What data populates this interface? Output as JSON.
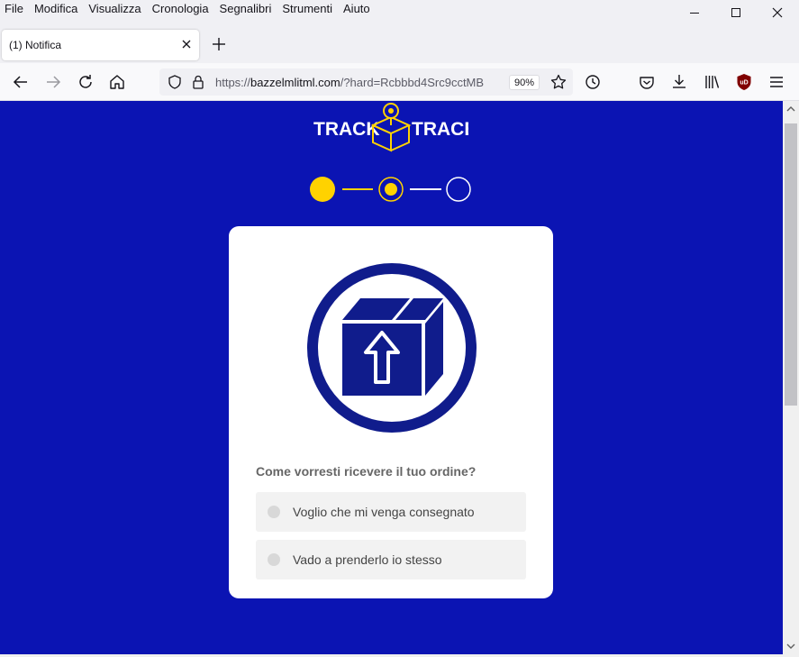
{
  "menu": [
    "File",
    "Modifica",
    "Visualizza",
    "Cronologia",
    "Segnalibri",
    "Strumenti",
    "Aiuto"
  ],
  "tab": {
    "title": "(1) Notifica"
  },
  "navbar": {
    "url_scheme": "https://",
    "url_host": "bazzelmlitml.com",
    "url_path": "/?hard=Rcbbbd4Src9cctMB",
    "zoom": "90%"
  },
  "page": {
    "logo_left": "TRACK",
    "logo_right": "TRACE",
    "progress_step": 2,
    "progress_total": 3,
    "question": "Come vorresti ricevere il tuo ordine?",
    "options": [
      "Voglio che mi venga consegnato",
      "Vado a prenderlo io stesso"
    ]
  },
  "colors": {
    "page_bg": "#0b14b3",
    "accent_yellow": "#ffd200",
    "icon_navy": "#101c8c",
    "card_bg": "#ffffff",
    "option_bg": "#f2f2f2"
  }
}
